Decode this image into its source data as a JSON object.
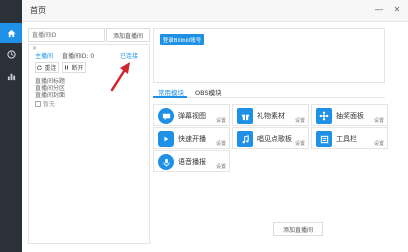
{
  "window": {
    "title": "首页",
    "minimize": "—",
    "close": "✕"
  },
  "nav": {
    "items": [
      {
        "icon": "home-icon"
      },
      {
        "icon": "clock-icon"
      },
      {
        "icon": "bar-chart-icon"
      }
    ]
  },
  "room": {
    "input_placeholder": "直播间ID",
    "add_button": "添加直播间",
    "close": "✕",
    "anchor": "主播间",
    "room_id": "直播间ID: 0",
    "status": "已连接",
    "retry_button": "重连",
    "pause_button": "断开",
    "info": [
      "直播间标题",
      "直播间分区",
      "直播间封面"
    ],
    "cover_alt": "暂无"
  },
  "right": {
    "login_button": "登录Bilibili账号",
    "tabs": [
      "常用模块",
      "OBS模块"
    ],
    "active_tab": 0,
    "tools": [
      {
        "label": "弹幕视图",
        "icon": "chat-icon",
        "settings": "设置"
      },
      {
        "label": "礼物素材",
        "icon": "gift-icon",
        "settings": "设置"
      },
      {
        "label": "抽奖面板",
        "icon": "lottery-icon",
        "settings": "设置"
      },
      {
        "label": "快速开播",
        "icon": "play-icon",
        "settings": "设置"
      },
      {
        "label": "唱见点歌板",
        "icon": "music-icon",
        "settings": "设置"
      },
      {
        "label": "工具栏",
        "icon": "toolbar-icon",
        "settings": "设置"
      },
      {
        "label": "语音播报",
        "icon": "microphone-icon",
        "settings": "设置"
      }
    ],
    "bottom_add_button": "添加直播间"
  },
  "colors": {
    "accent": "#1e90e6",
    "sidebar": "#2b3138",
    "annotation": "#d0262b"
  }
}
